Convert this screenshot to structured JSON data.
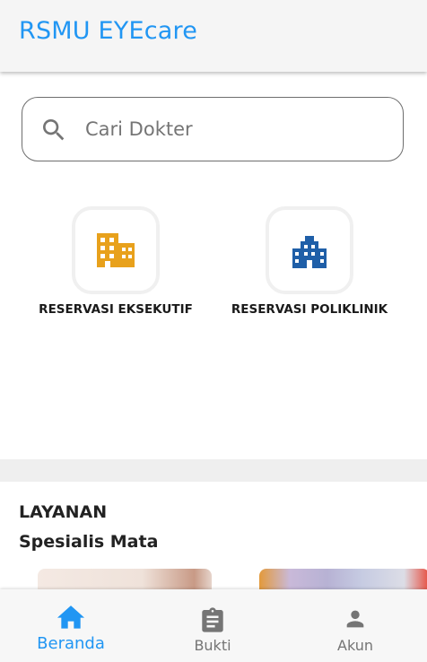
{
  "app_bar": {
    "title": "RSMU EYEcare"
  },
  "search": {
    "placeholder": "Cari Dokter",
    "icon": "search-icon"
  },
  "menu": [
    {
      "label": "RESERVASI EKSEKUTIF",
      "icon": "office-building-icon",
      "color": "#e8a11c"
    },
    {
      "label": "RESERVASI POLIKLINIK",
      "icon": "city-building-icon",
      "color": "#1f5fa8"
    }
  ],
  "services": {
    "title": "LAYANAN",
    "subtitle": "Spesialis Mata"
  },
  "bottom_nav": {
    "active_color": "#2196f3",
    "items": [
      {
        "label": "Beranda",
        "icon": "home-icon",
        "active": true
      },
      {
        "label": "Bukti",
        "icon": "clipboard-icon",
        "active": false
      },
      {
        "label": "Akun",
        "icon": "person-icon",
        "active": false
      }
    ]
  }
}
